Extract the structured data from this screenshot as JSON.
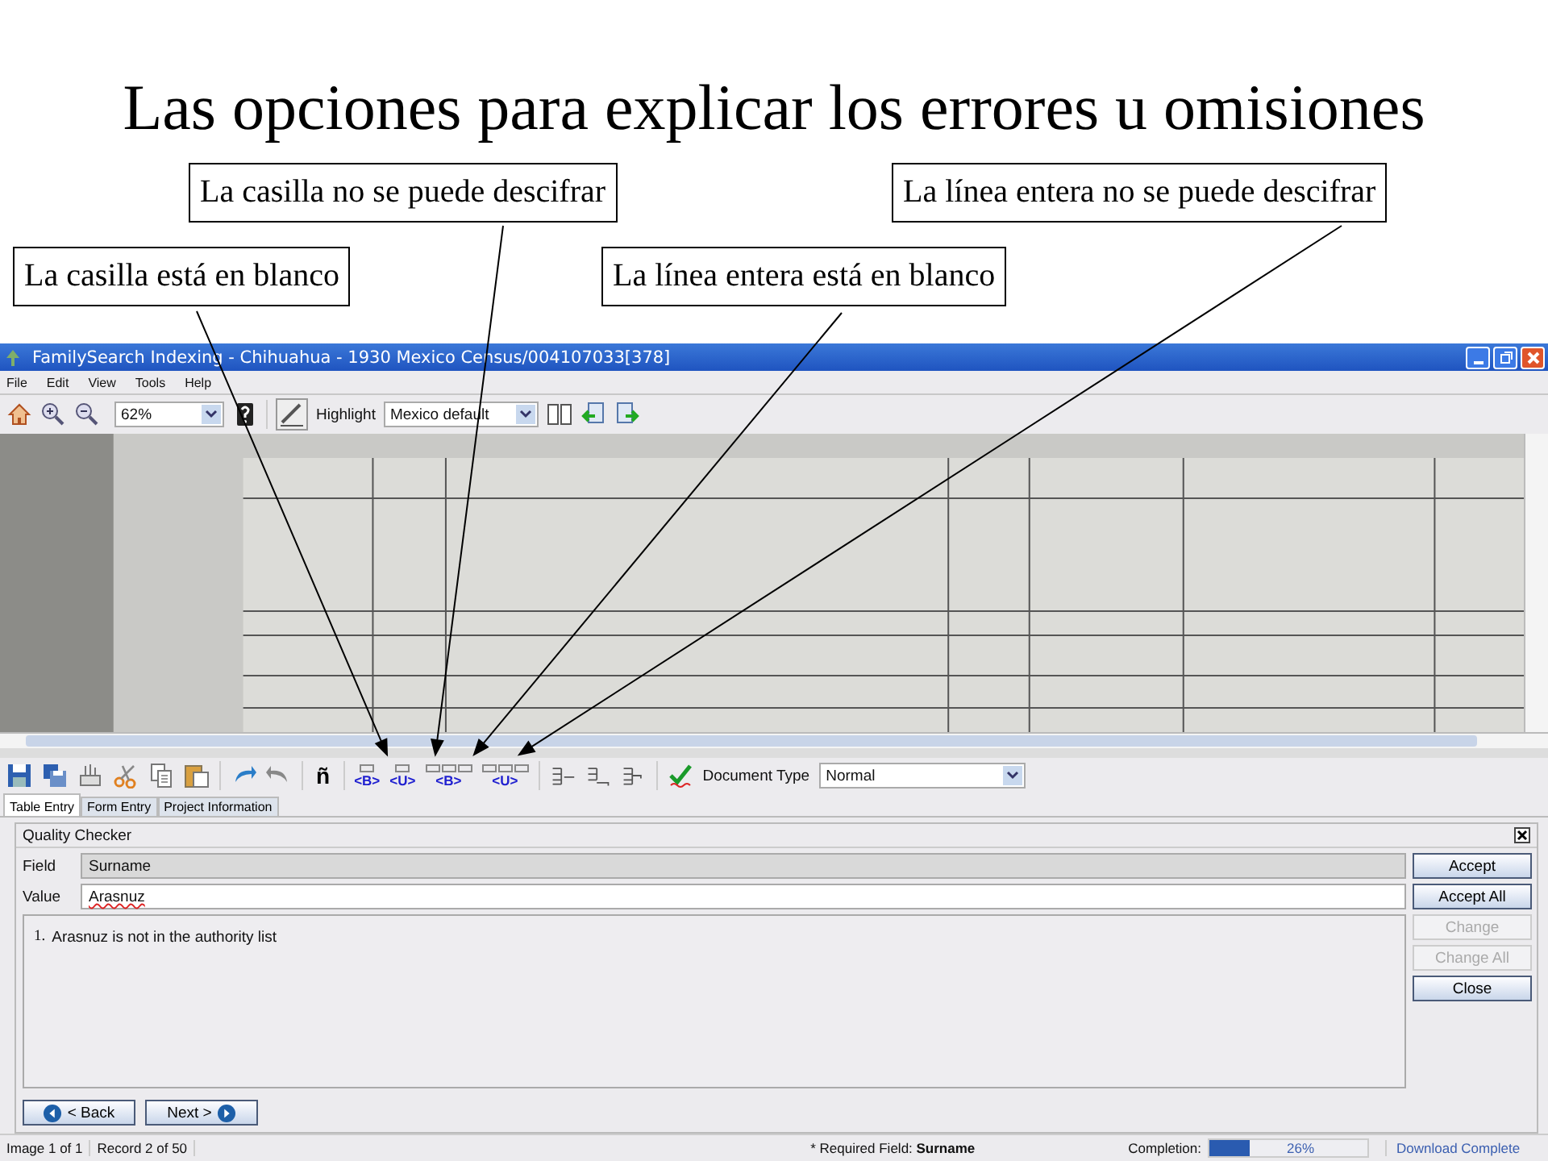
{
  "slide_title": "Las opciones para explicar los errores u omisiones",
  "callouts": [
    {
      "text": "La casilla no se puede descifrar"
    },
    {
      "text": "La línea entera no se puede descifrar"
    },
    {
      "text": "La casilla está en blanco"
    },
    {
      "text": "La línea entera está en blanco"
    }
  ],
  "window": {
    "title": "FamilySearch Indexing - Chihuahua - 1930 Mexico Census/004107033[378]",
    "menu": [
      "File",
      "Edit",
      "View",
      "Tools",
      "Help"
    ],
    "toolbar": {
      "zoom": "62%",
      "highlight_label": "Highlight",
      "highlight_value": "Mexico default"
    },
    "entry_toolbar": {
      "special_char": "ñ",
      "markers": [
        {
          "text": "<B>",
          "kind": "field"
        },
        {
          "text": "<U>",
          "kind": "field"
        },
        {
          "text": "<B>",
          "kind": "row"
        },
        {
          "text": "<U>",
          "kind": "row"
        }
      ],
      "document_type_label": "Document Type",
      "document_type": "Normal"
    },
    "tabs": [
      {
        "label": "Table Entry",
        "selected": true
      },
      {
        "label": "Form Entry",
        "selected": false
      },
      {
        "label": "Project Information",
        "selected": false
      }
    ],
    "quality_checker": {
      "title": "Quality Checker",
      "field_label": "Field",
      "field_value": "Surname",
      "value_label": "Value",
      "value": "Arasnuz",
      "messages": [
        {
          "number": "1.",
          "text": "Arasnuz is not in the authority list"
        }
      ],
      "buttons": [
        {
          "label": "Accept",
          "disabled": false
        },
        {
          "label": "Accept All",
          "disabled": false
        },
        {
          "label": "Change",
          "disabled": true
        },
        {
          "label": "Change All",
          "disabled": true
        },
        {
          "label": "Close",
          "disabled": false
        }
      ]
    },
    "nav_buttons": [
      {
        "label": "< Back",
        "kind": "back"
      },
      {
        "label": "Next >",
        "kind": "next"
      }
    ],
    "status_bar": {
      "image": "Image 1 of 1",
      "record": "Record 2 of 50",
      "required_label": "* Required Field:",
      "required_field": "Surname",
      "completion_label": "Completion:",
      "completion": {
        "level": 0.26,
        "reading": "26%"
      },
      "download": "Download Complete"
    }
  }
}
